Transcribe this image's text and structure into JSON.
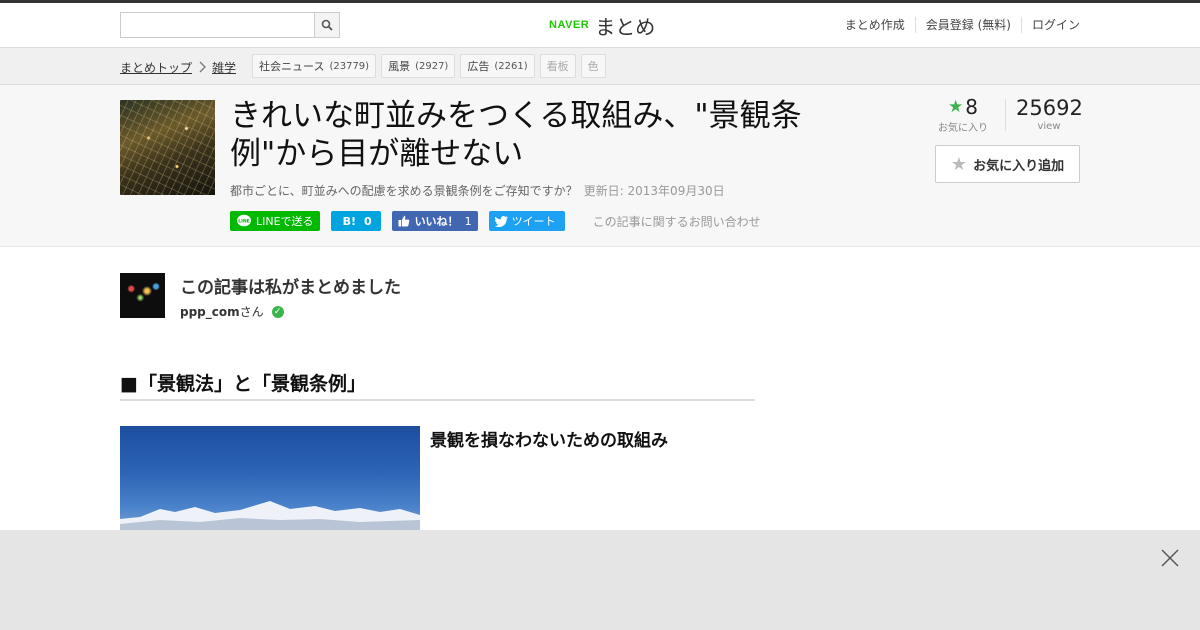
{
  "header": {
    "search": {
      "placeholder": "",
      "value": ""
    },
    "logo": {
      "brand": "NAVER",
      "service": "まとめ"
    },
    "nav": [
      "まとめ作成",
      "会員登録 (無料)",
      "ログイン"
    ]
  },
  "breadcrumb": {
    "items": [
      "まとめトップ",
      "雑学"
    ],
    "separator": ">"
  },
  "tags": [
    {
      "label": "社会ニュース",
      "count": "(23779)"
    },
    {
      "label": "風景",
      "count": "(2927)"
    },
    {
      "label": "広告",
      "count": "(2261)"
    },
    {
      "label": "看板",
      "count": ""
    },
    {
      "label": "色",
      "count": ""
    }
  ],
  "article": {
    "title": "きれいな町並みをつくる取組み、\"景観条例\"から目が離せない",
    "description": "都市ごとに、町並みへの配慮を求める景観条例をご存知ですか？",
    "updated": "更新日: 2013年09月30日",
    "favorites": "8",
    "favorites_label": "お気に入り",
    "views": "25692",
    "views_label": "view",
    "fav_button": "お気に入り追加"
  },
  "share": {
    "line": "LINEで送る",
    "hatena_icon": "B!",
    "hatena_count": "0",
    "facebook": "いいね！",
    "facebook_count": "1",
    "twitter": "ツイート",
    "inquiry": "この記事に関するお問い合わせ"
  },
  "author": {
    "heading": "この記事は私がまとめました",
    "name": "ppp_com",
    "suffix": "さん"
  },
  "content": {
    "section_heading": "■「景観法」と「景観条例」",
    "item_title": "景観を損なわないための取組み"
  },
  "colors": {
    "brand_green": "#1ec800",
    "line_green": "#00b900",
    "hatena_blue": "#00a4de",
    "facebook_blue": "#4267b2",
    "twitter_blue": "#1da1f2",
    "star_green": "#3cb44b"
  },
  "icons": [
    "search-icon",
    "chevron-right-icon",
    "star-icon",
    "verified-check-icon",
    "close-icon",
    "line-icon",
    "thumbs-up-icon",
    "twitter-bird-icon"
  ]
}
